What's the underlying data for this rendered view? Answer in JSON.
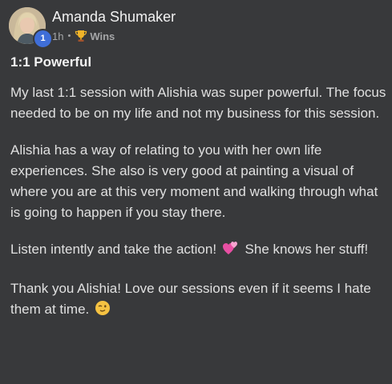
{
  "post": {
    "author": "Amanda Shumaker",
    "level": "1",
    "time_ago": "1h",
    "separator": "•",
    "category": "Wins",
    "category_icon": "trophy-icon",
    "title": "1:1 Powerful",
    "paragraphs": [
      "My last 1:1 session with Alishia was super powerful. The focus needed to be on my life and not my business for this session.",
      "Alishia has a way of relating to you with her own life experiences. She also is very good at painting a visual of where you are at this very moment and walking through what is going to happen if you stay there.",
      {
        "before": "Listen intently and take the action!",
        "emoji": "two-hearts-icon",
        "after": "She knows her stuff!"
      },
      {
        "before": "Thank you Alishia! Love our sessions even if it seems I hate them at time.",
        "emoji": "winking-face-icon",
        "after": ""
      }
    ]
  },
  "colors": {
    "background": "#38393b",
    "level_badge": "#3f6ed8",
    "text": "#e0e0e0",
    "meta": "#a5a6a8"
  }
}
